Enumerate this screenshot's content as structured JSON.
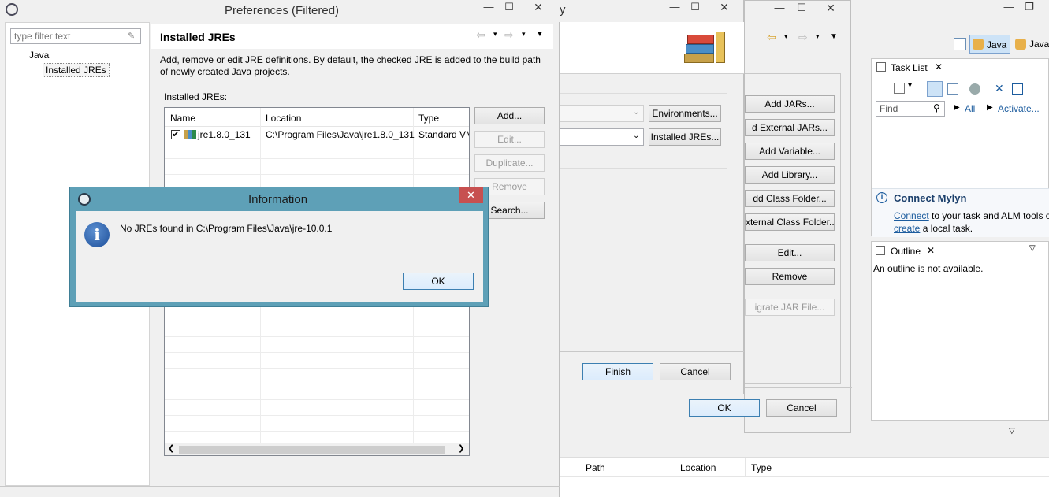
{
  "prefs": {
    "title": "Preferences (Filtered)",
    "filter_placeholder": "type filter text",
    "tree": [
      "Java",
      "Installed JREs"
    ],
    "page_title": "Installed JREs",
    "description": "Add, remove or edit JRE definitions. By default, the checked JRE is added to the build path of newly created Java projects.",
    "list_label": "Installed JREs:",
    "columns": [
      "Name",
      "Location",
      "Type"
    ],
    "rows": [
      {
        "name": "jre1.8.0_131",
        "location": "C:\\Program Files\\Java\\jre1.8.0_131",
        "type": "Standard VM",
        "checked": true
      }
    ],
    "buttons": [
      "Add...",
      "Edit...",
      "Duplicate...",
      "Remove",
      "Search..."
    ]
  },
  "dialog": {
    "title": "Information",
    "message": "No JREs found in C:\\Program Files\\Java\\jre-10.0.1",
    "ok": "OK"
  },
  "mid_window": {
    "title_fragment": "y",
    "environments": "Environments...",
    "installed_jres": "Installed JREs...",
    "finish": "Finish",
    "cancel": "Cancel"
  },
  "build_path": {
    "buttons": [
      "Add JARs...",
      "d External JARs...",
      "Add Variable...",
      "Add Library...",
      "dd Class Folder...",
      "xternal Class Folder...",
      "Edit...",
      "Remove",
      "igrate JAR File..."
    ],
    "ok": "OK",
    "cancel": "Cancel"
  },
  "ide": {
    "perspective_java": "Java",
    "perspective_java2": "Java",
    "task_list_title": "Task List",
    "find_placeholder": "Find",
    "all_label": "All",
    "activate_label": "Activate...",
    "connect_title": "Connect Mylyn",
    "connect_link": "Connect",
    "connect_text": " to your task and ALM tools o",
    "create_link": "create",
    "create_text": " a local task.",
    "outline_title": "Outline",
    "outline_text": "An outline is not available.",
    "bottom_columns": [
      "Path",
      "Location",
      "Type"
    ]
  }
}
